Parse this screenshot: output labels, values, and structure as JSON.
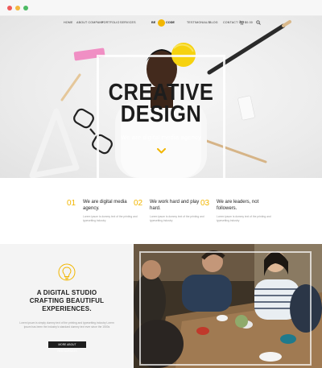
{
  "nav": {
    "left": [
      "HOME",
      "ABOUT COMPANY",
      "PORTFOLIO",
      "SERVICES"
    ],
    "right": [
      "TESTIMONIALS",
      "BLOG",
      "CONTACT US"
    ],
    "cart": "$0.00"
  },
  "logo": {
    "text_left": "BE",
    "text_right": "CODE",
    "circle_text": "BE"
  },
  "hero": {
    "title_line1": "CREATIVE",
    "title_line2": "DESIGN",
    "subtitle": "We are digital media agency",
    "chevron_icon": "chevron-down-icon"
  },
  "features": [
    {
      "num": "01",
      "title": "We are digital media agency.",
      "text": "Lorem ipsum is dummy text of the printing and typesetting industry"
    },
    {
      "num": "02",
      "title": "We work hard and play hard.",
      "text": "Lorem ipsum is dummy text of the printing and typesetting industry"
    },
    {
      "num": "03",
      "title": "We are leaders, not followers.",
      "text": "Lorem ipsum is dummy text of the printing and typesetting industry"
    }
  ],
  "studio": {
    "icon": "lightbulb-icon",
    "title_line1": "A DIGITAL STUDIO",
    "title_line2": "CRAFTING BEAUTIFUL",
    "title_line3": "EXPERIENCES.",
    "text": "Lorem ipsum is simply dummy text of the printing and typesetting industry Lorem ipsum has been the industry's standard dummy text ever since the 1500s",
    "button": "MORE ABOUT RESTAURANTS"
  },
  "colors": {
    "accent": "#f2b600",
    "dark": "#1d1d1d",
    "muted": "#999999"
  }
}
